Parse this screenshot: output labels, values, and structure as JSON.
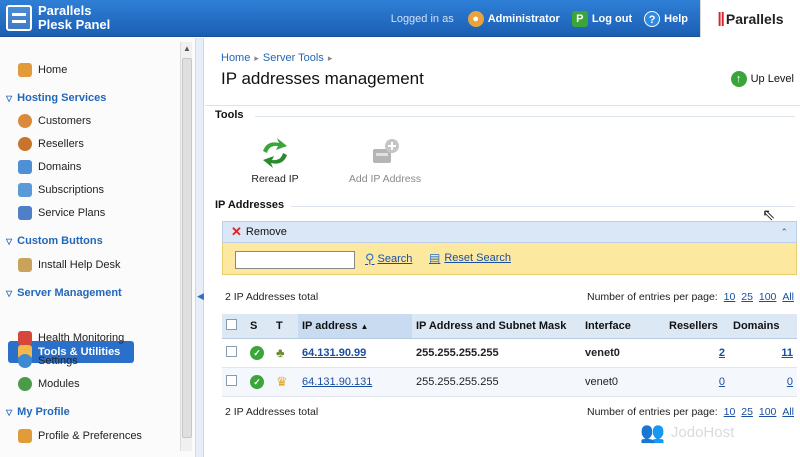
{
  "header": {
    "logo_line1": "Parallels",
    "logo_line2": "Plesk Panel",
    "logged_in_as": "Logged in as",
    "user": "Administrator",
    "logout": "Log out",
    "help": "Help",
    "brand": "Parallels"
  },
  "sidebar": {
    "home": "Home",
    "sections": [
      {
        "title": "Hosting Services",
        "items": [
          "Customers",
          "Resellers",
          "Domains",
          "Subscriptions",
          "Service Plans"
        ]
      },
      {
        "title": "Custom Buttons",
        "items": [
          "Install Help Desk"
        ]
      },
      {
        "title": "Server Management",
        "items": [
          "Tools & Utilities",
          "Health Monitoring",
          "Settings",
          "Modules"
        ]
      },
      {
        "title": "My Profile",
        "items": [
          "Profile & Preferences"
        ]
      }
    ]
  },
  "main": {
    "breadcrumb": [
      "Home",
      "Server Tools"
    ],
    "title": "IP addresses management",
    "up_level": "Up Level",
    "tools_heading": "Tools",
    "tools": [
      {
        "label": "Reread IP",
        "enabled": true
      },
      {
        "label": "Add IP Address",
        "enabled": false
      }
    ],
    "ip_heading": "IP Addresses",
    "remove": "Remove",
    "search_value": "",
    "search": "Search",
    "reset_search": "Reset Search",
    "total": "2 IP Addresses total",
    "per_page_label": "Number of entries per page:",
    "per_page_options": [
      "10",
      "25",
      "100",
      "All"
    ],
    "columns": [
      "S",
      "T",
      "IP address",
      "IP Address and Subnet Mask",
      "Interface",
      "Resellers",
      "Domains"
    ],
    "rows": [
      {
        "ip": "64.131.90.99",
        "mask": "255.255.255.255",
        "interface": "venet0",
        "resellers": "2",
        "domains": "11"
      },
      {
        "ip": "64.131.90.131",
        "mask": "255.255.255.255",
        "interface": "venet0",
        "resellers": "0",
        "domains": "0"
      }
    ]
  },
  "watermark": "JodoHost"
}
